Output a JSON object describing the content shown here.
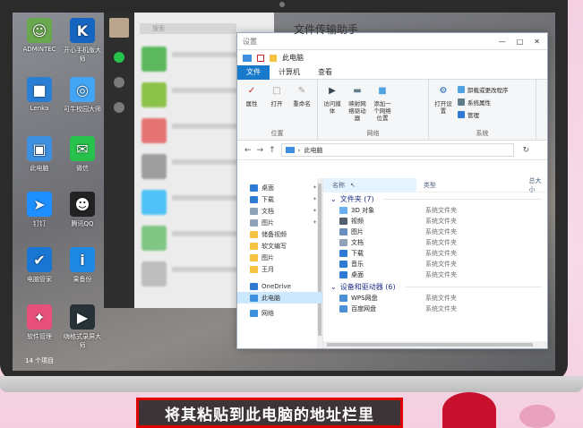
{
  "desktop": {
    "icons": [
      {
        "label": "ADMINTEC",
        "glyph": "☺",
        "color": "#6aa84f"
      },
      {
        "label": "Lenka",
        "glyph": "■",
        "color": "#2a7fd4"
      },
      {
        "label": "此电脑",
        "glyph": "▣",
        "color": "#3d8fe0"
      },
      {
        "label": "钉钉",
        "glyph": "➤",
        "color": "#1e8fff"
      },
      {
        "label": "电脑管家",
        "glyph": "✔",
        "color": "#1976d2"
      },
      {
        "label": "软件管理",
        "glyph": "✦",
        "color": "#e84f7a"
      },
      {
        "label": "开心手机版大师",
        "glyph": "K",
        "color": "#1565c0"
      },
      {
        "label": "可牛校园大师",
        "glyph": "◎",
        "color": "#42a5f5"
      },
      {
        "label": "微信",
        "glyph": "✉",
        "color": "#27c24c"
      },
      {
        "label": "腾讯QQ",
        "glyph": "☻",
        "color": "#222222"
      },
      {
        "label": "果备份",
        "glyph": "i",
        "color": "#1e88e5"
      },
      {
        "label": "嗨格式录屏大师",
        "glyph": "▶",
        "color": "#263238"
      }
    ]
  },
  "chat": {
    "search_placeholder": "搜索",
    "title": "文件传输助手"
  },
  "explorer": {
    "window_title": "设置",
    "window_buttons": [
      "—",
      "□",
      "✕"
    ],
    "quick_access_title": "此电脑",
    "tabs": [
      {
        "label": "文件",
        "active": true
      },
      {
        "label": "计算机",
        "active": false
      },
      {
        "label": "查看",
        "active": false
      }
    ],
    "ribbon": {
      "groups": [
        {
          "name": "位置",
          "buttons": [
            {
              "label": "属性",
              "glyph": "✓",
              "color": "#c62828"
            },
            {
              "label": "打开",
              "glyph": "□",
              "color": "#9e9e9e"
            },
            {
              "label": "重命名",
              "glyph": "✎",
              "color": "#9e9e9e"
            }
          ]
        },
        {
          "name": "网络",
          "buttons": [
            {
              "label": "访问媒体",
              "glyph": "▶",
              "color": "#37474f"
            },
            {
              "label": "映射网络驱动器",
              "glyph": "▬",
              "color": "#607d8b"
            },
            {
              "label": "添加一个网络位置",
              "glyph": "■",
              "color": "#4fa3e0"
            }
          ]
        },
        {
          "name": "系统",
          "buttons": [
            {
              "label": "打开设置",
              "glyph": "⚙",
              "color": "#1565c0"
            }
          ],
          "small": [
            "卸载或更改程序",
            "系统属性",
            "管理"
          ]
        }
      ]
    },
    "address": {
      "back": "←",
      "forward": "→",
      "up": "↑",
      "crumb": "此电脑",
      "refresh": "↻"
    },
    "nav": [
      {
        "label": "桌面",
        "color": "#2e7bd6",
        "pinned": true
      },
      {
        "label": "下载",
        "color": "#2e7bd6",
        "pinned": true
      },
      {
        "label": "文档",
        "color": "#8fa3b8",
        "pinned": true
      },
      {
        "label": "图片",
        "color": "#8fa3b8",
        "pinned": true
      },
      {
        "label": "储备视频",
        "color": "#f5c242",
        "pinned": false
      },
      {
        "label": "软文编写",
        "color": "#f5c242",
        "pinned": false
      },
      {
        "label": "图片",
        "color": "#f5c242",
        "pinned": false
      },
      {
        "label": "王月",
        "color": "#f5c242",
        "pinned": false
      },
      {
        "label": "OneDrive",
        "color": "#2e7bd6",
        "pinned": false
      },
      {
        "label": "此电脑",
        "color": "#3d8fe0",
        "pinned": false,
        "selected": true
      },
      {
        "label": "网络",
        "color": "#3d8fe0",
        "pinned": false
      }
    ],
    "columns": {
      "name": "名称",
      "type": "类型",
      "size": "总大小"
    },
    "sections": [
      {
        "title": "文件夹 (7)",
        "rows": [
          {
            "name": "3D 对象",
            "type": "系统文件夹",
            "color": "#6ab0f0"
          },
          {
            "name": "视频",
            "type": "系统文件夹",
            "color": "#555f6d"
          },
          {
            "name": "图片",
            "type": "系统文件夹",
            "color": "#6a8fbf"
          },
          {
            "name": "文档",
            "type": "系统文件夹",
            "color": "#8fa3b8"
          },
          {
            "name": "下载",
            "type": "系统文件夹",
            "color": "#2e7bd6"
          },
          {
            "name": "音乐",
            "type": "系统文件夹",
            "color": "#2e7bd6"
          },
          {
            "name": "桌面",
            "type": "系统文件夹",
            "color": "#2e7bd6"
          }
        ]
      },
      {
        "title": "设备和驱动器 (6)",
        "rows": [
          {
            "name": "WPS网盘",
            "type": "系统文件夹",
            "color": "#4a90d9"
          },
          {
            "name": "百度网盘",
            "type": "系统文件夹",
            "color": "#4a90d9"
          }
        ]
      }
    ]
  },
  "taskbar_status": "14 个项目",
  "caption": "将其粘贴到此电脑的地址栏里"
}
